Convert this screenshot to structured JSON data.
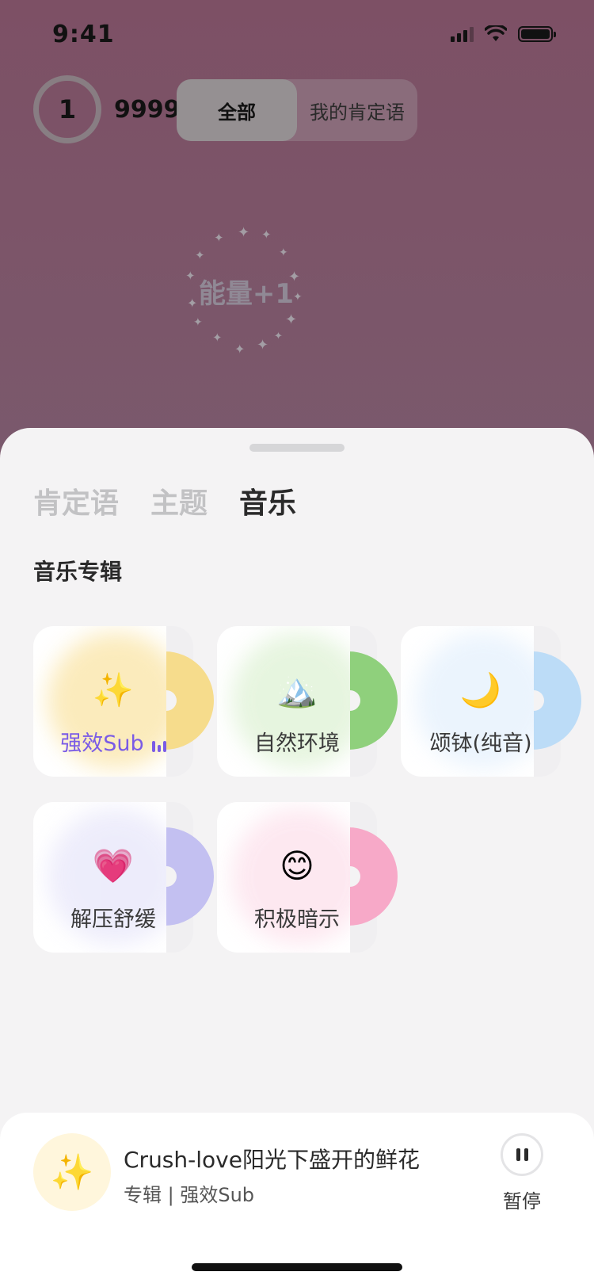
{
  "status_bar": {
    "time": "9:41"
  },
  "header": {
    "count_current": "1",
    "count_total": "9999",
    "segments": [
      {
        "label": "全部",
        "active": true
      },
      {
        "label": "我的肯定语",
        "active": false
      }
    ]
  },
  "energy": {
    "text": "能量+1"
  },
  "sheet": {
    "tabs": [
      {
        "label": "肯定语"
      },
      {
        "label": "主题"
      },
      {
        "label": "音乐",
        "active": true
      }
    ],
    "section_title": "音乐专辑",
    "albums": [
      {
        "label": "强效Sub",
        "emoji": "✨",
        "accent": "#f6dc8c",
        "playing": true
      },
      {
        "label": "自然环境",
        "emoji": "🏔️",
        "accent": "#8fd07c"
      },
      {
        "label": "颂钵(纯音)",
        "emoji": "🌙",
        "accent": "#bcdcf7"
      },
      {
        "label": "解压舒缓",
        "emoji": "💗",
        "accent": "#c3c0f1"
      },
      {
        "label": "积极暗示",
        "emoji": "😊",
        "accent": "#f7a9c8"
      }
    ]
  },
  "player": {
    "cover_emoji": "✨",
    "title": "Crush-love阳光下盛开的鲜花",
    "subtitle": "专辑 | 强效Sub",
    "pause_label": "暂停"
  }
}
